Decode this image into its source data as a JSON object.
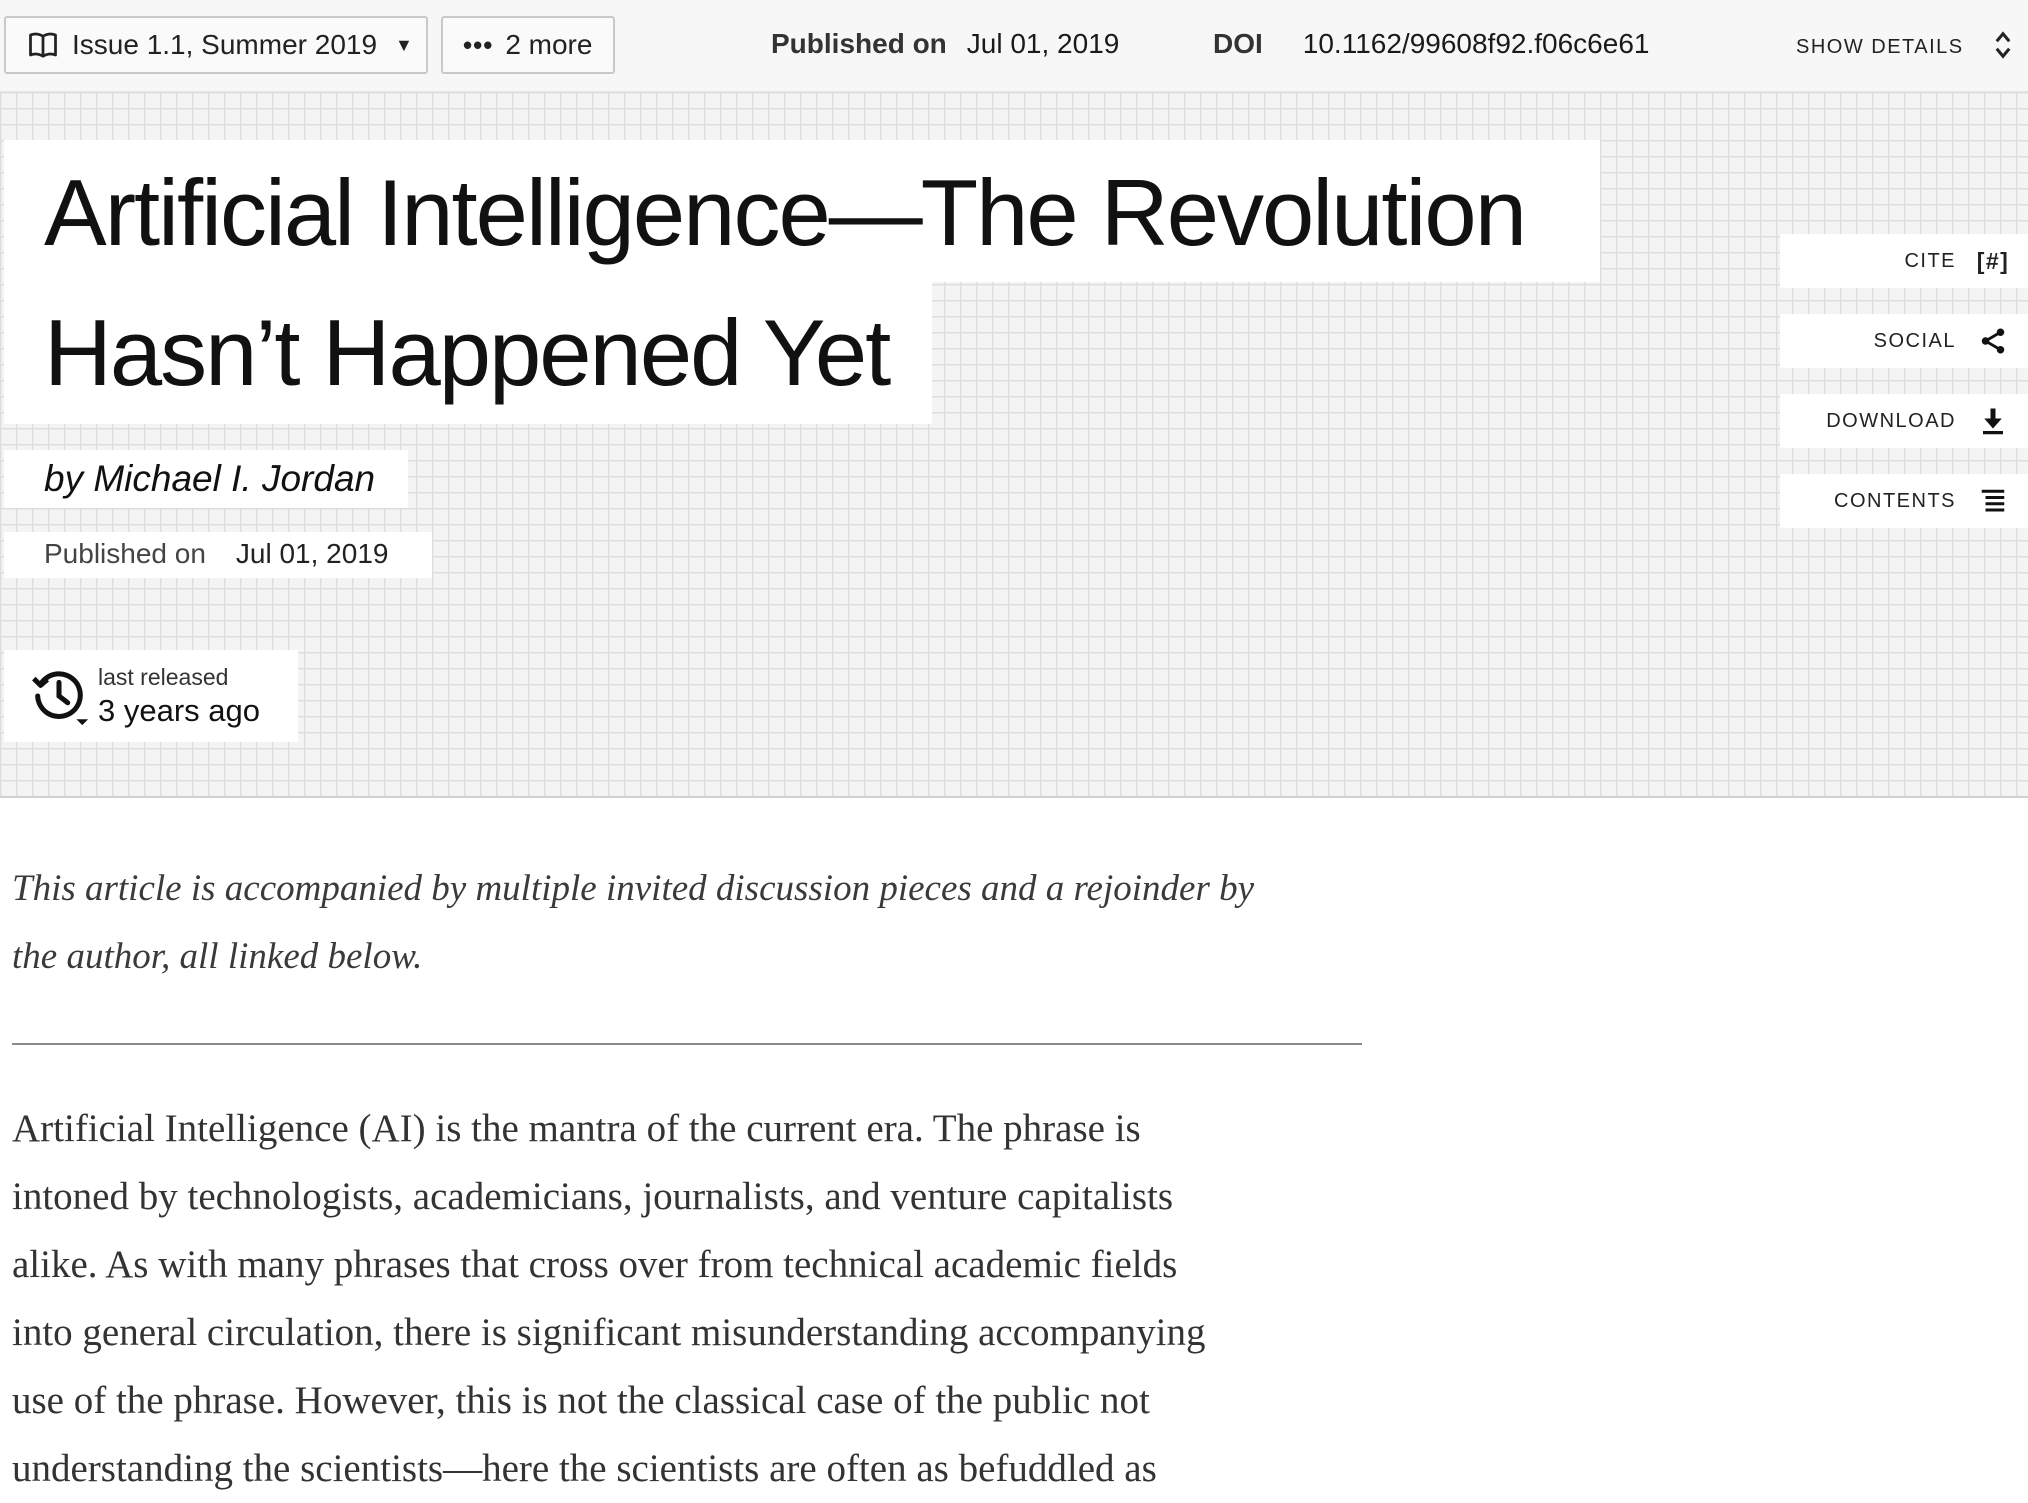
{
  "topbar": {
    "issue_label": "Issue 1.1, Summer 2019",
    "more_label": "2 more",
    "published_label": "Published on",
    "published_date": "Jul 01, 2019",
    "doi_label": "DOI",
    "doi_value": "10.1162/99608f92.f06c6e61",
    "show_details": "SHOW DETAILS"
  },
  "hero": {
    "title_line1": "Artificial Intelligence—The Revolution",
    "title_line2": "Hasn’t Happened Yet",
    "byline": "by Michael I. Jordan",
    "published_label": "Published on",
    "published_date": "Jul 01, 2019",
    "release_small": "last released",
    "release_big": "3 years ago"
  },
  "actions": {
    "cite": "CITE",
    "cite_icon_text": "[#]",
    "social": "SOCIAL",
    "download": "DOWNLOAD",
    "contents": "CONTENTS"
  },
  "article": {
    "intro_line1": "This article is accompanied by multiple invited discussion pieces and a rejoinder by",
    "intro_line2": "the author, all linked below.",
    "body_lines": [
      "Artificial Intelligence (AI) is the mantra of the current era. The phrase is",
      "intoned by technologists, academicians, journalists, and venture capitalists",
      "alike. As with many phrases that cross over from technical academic fields",
      "into general circulation, there is significant misunderstanding accompanying",
      "use of the phrase. However, this is not the classical case of the public not",
      "understanding the scientists—here the scientists are often as befuddled as"
    ]
  },
  "icons": {
    "issue": "book-icon",
    "issue_caret": "caret-down-icon",
    "more": "ellipsis-icon",
    "show_details": "chevron-updown-icon",
    "cite": "hash-bracket-icon",
    "social": "share-icon",
    "download": "download-icon",
    "contents": "list-icon",
    "release": "history-icon"
  }
}
